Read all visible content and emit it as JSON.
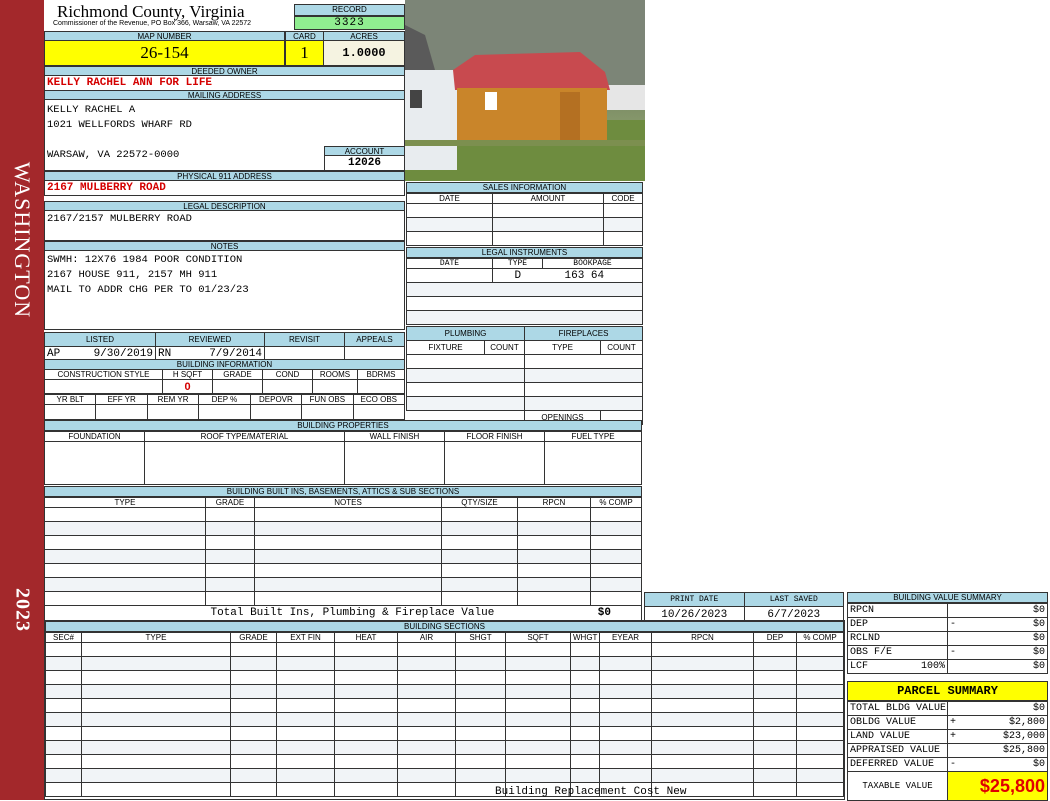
{
  "sidebar": {
    "district": "WASHINGTON",
    "year": "2023"
  },
  "header": {
    "title": "Richmond County, Virginia",
    "subtitle": "Commissioner of the Revenue, PO Box 366, Warsaw, VA 22572",
    "record_label": "RECORD",
    "record": "3323"
  },
  "parcel": {
    "map_label": "MAP NUMBER",
    "map": "26-154",
    "card_label": "CARD",
    "card": "1",
    "acres_label": "ACRES",
    "acres": "1.0000"
  },
  "owner": {
    "label": "DEEDED OWNER",
    "value": "KELLY RACHEL ANN FOR LIFE"
  },
  "mailing": {
    "label": "MAILING ADDRESS",
    "lines": [
      "KELLY RACHEL A",
      "1021 WELLFORDS WHARF RD",
      "",
      "WARSAW, VA 22572-0000"
    ],
    "account_label": "ACCOUNT",
    "account": "12026"
  },
  "physical": {
    "label": "PHYSICAL 911 ADDRESS",
    "value": "2167 MULBERRY ROAD"
  },
  "legal": {
    "label": "LEGAL DESCRIPTION",
    "value": "2167/2157 MULBERRY ROAD"
  },
  "notes": {
    "label": "NOTES",
    "lines": [
      "SWMH: 12X76 1984 POOR CONDITION",
      "2167 HOUSE 911, 2157 MH 911",
      "MAIL TO ADDR CHG PER TO 01/23/23"
    ]
  },
  "review": {
    "headers": [
      "LISTED",
      "REVIEWED",
      "REVISIT",
      "APPEALS"
    ],
    "listed_by": "AP",
    "listed_date": "9/30/2019",
    "reviewed_by": "RN",
    "reviewed_date": "7/9/2014"
  },
  "building_info": {
    "label": "BUILDING INFORMATION",
    "headers1": [
      "CONSTRUCTION STYLE",
      "H SQFT",
      "GRADE",
      "COND",
      "ROOMS",
      "BDRMS"
    ],
    "hsqft": "0",
    "headers2": [
      "YR BLT",
      "EFF YR",
      "REM YR",
      "DEP %",
      "DEPOVR",
      "FUN OBS",
      "ECO OBS"
    ]
  },
  "sales": {
    "label": "SALES INFORMATION",
    "headers": [
      "DATE",
      "AMOUNT",
      "CODE"
    ]
  },
  "instruments": {
    "label": "LEGAL INSTRUMENTS",
    "headers": [
      "DATE",
      "TYPE",
      "BOOKPAGE"
    ],
    "rows": [
      {
        "date": "",
        "type": "D",
        "bookpage": "163 64"
      }
    ]
  },
  "plumbing": {
    "label": "PLUMBING",
    "headers": [
      "FIXTURE",
      "COUNT"
    ]
  },
  "fireplaces": {
    "label": "FIREPLACES",
    "headers": [
      "TYPE",
      "COUNT"
    ],
    "openings": "OPENINGS"
  },
  "properties": {
    "label": "BUILDING PROPERTIES",
    "headers": [
      "FOUNDATION",
      "ROOF TYPE/MATERIAL",
      "WALL FINISH",
      "FLOOR FINISH",
      "FUEL TYPE"
    ]
  },
  "builtins": {
    "label": "BUILDING BUILT INS, BASEMENTS, ATTICS & SUB SECTIONS",
    "headers": [
      "TYPE",
      "GRADE",
      "NOTES",
      "QTY/SIZE",
      "RPCN",
      "% COMP"
    ],
    "total_label": "Total Built Ins, Plumbing & Fireplace Value",
    "total": "$0"
  },
  "dates": {
    "print_label": "PRINT DATE",
    "print": "10/26/2023",
    "saved_label": "LAST SAVED",
    "saved": "6/7/2023"
  },
  "sections": {
    "label": "BUILDING SECTIONS",
    "headers": [
      "SEC#",
      "TYPE",
      "GRADE",
      "EXT FIN",
      "HEAT",
      "AIR",
      "SHGT",
      "SQFT",
      "WHGT",
      "EYEAR",
      "RPCN",
      "DEP",
      "% COMP"
    ],
    "footer": "Building Replacement Cost New"
  },
  "value_summary": {
    "label": "BUILDING VALUE SUMMARY",
    "rows": [
      {
        "k": "RPCN",
        "op": "",
        "v": "$0"
      },
      {
        "k": "DEP",
        "op": "-",
        "v": "$0"
      },
      {
        "k": "RCLND",
        "op": "",
        "v": "$0"
      },
      {
        "k": "OBS F/E",
        "op": "-",
        "v": "$0"
      },
      {
        "k": "LCF",
        "pct": "100%",
        "op": "",
        "v": "$0"
      }
    ]
  },
  "parcel_summary": {
    "title": "PARCEL SUMMARY",
    "rows": [
      {
        "k": "TOTAL BLDG VALUE",
        "op": "",
        "v": "$0"
      },
      {
        "k": "OBLDG VALUE",
        "op": "+",
        "v": "$2,800"
      },
      {
        "k": "LAND VALUE",
        "op": "+",
        "v": "$23,000"
      },
      {
        "k": "APPRAISED VALUE",
        "op": "",
        "v": "$25,800"
      },
      {
        "k": "DEFERRED VALUE",
        "op": "-",
        "v": "$0"
      }
    ],
    "taxable_label": "TAXABLE VALUE",
    "taxable": "$25,800"
  }
}
